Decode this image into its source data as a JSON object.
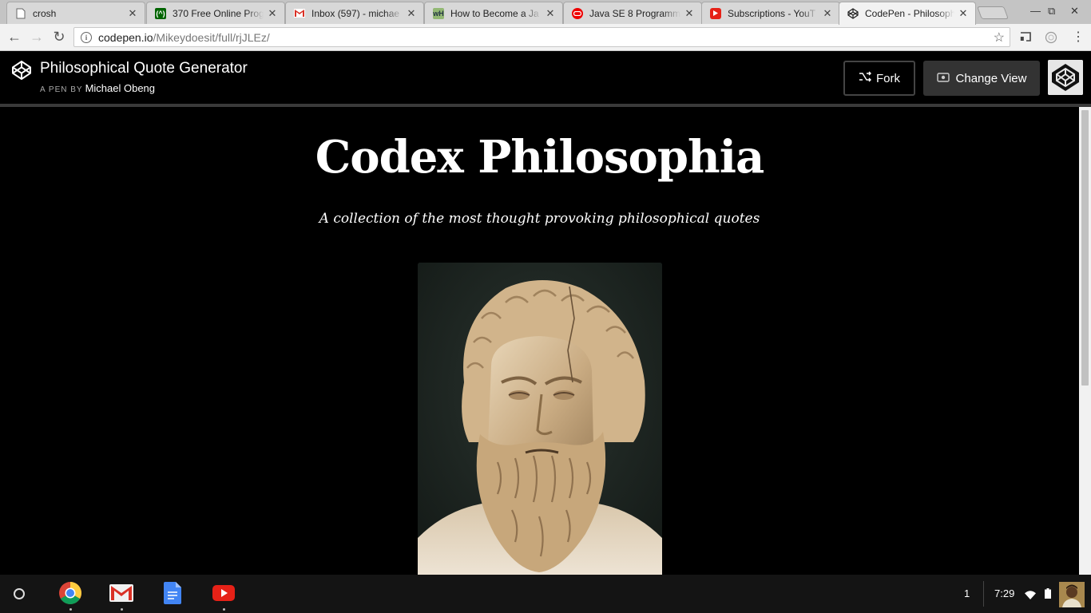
{
  "tabs": [
    {
      "title": "crosh",
      "icon": "document-icon",
      "active": false
    },
    {
      "title": "370 Free Online Prog",
      "icon": "freecodecamp-icon",
      "active": false
    },
    {
      "title": "Inbox (597) - michae",
      "icon": "gmail-icon",
      "active": false
    },
    {
      "title": "How to Become a Ja",
      "icon": "wikihow-icon",
      "active": false
    },
    {
      "title": "Java SE 8 Programm",
      "icon": "oracle-icon",
      "active": false
    },
    {
      "title": "Subscriptions - YouT",
      "icon": "youtube-icon",
      "active": false
    },
    {
      "title": "CodePen - Philosoph",
      "icon": "codepen-icon",
      "active": true
    }
  ],
  "address": {
    "host": "codepen.io",
    "path": "/Mikeydoesit/full/rjJLEz/"
  },
  "codepen": {
    "pen_title": "Philosophical Quote Generator",
    "by_label": "A PEN BY",
    "author": "Michael Obeng",
    "fork_label": "Fork",
    "change_view_label": "Change View"
  },
  "page": {
    "title": "Codex Philosophia",
    "subtitle": "A collection of the most thought provoking philosophical quotes"
  },
  "shelf": {
    "apps": [
      "chrome-icon",
      "gmail-icon",
      "google-docs-icon",
      "youtube-icon"
    ],
    "notification_count": "1",
    "time": "7:29"
  },
  "colors": {
    "background": "#000000",
    "text": "#ffffff",
    "button_dark": "#333333"
  }
}
